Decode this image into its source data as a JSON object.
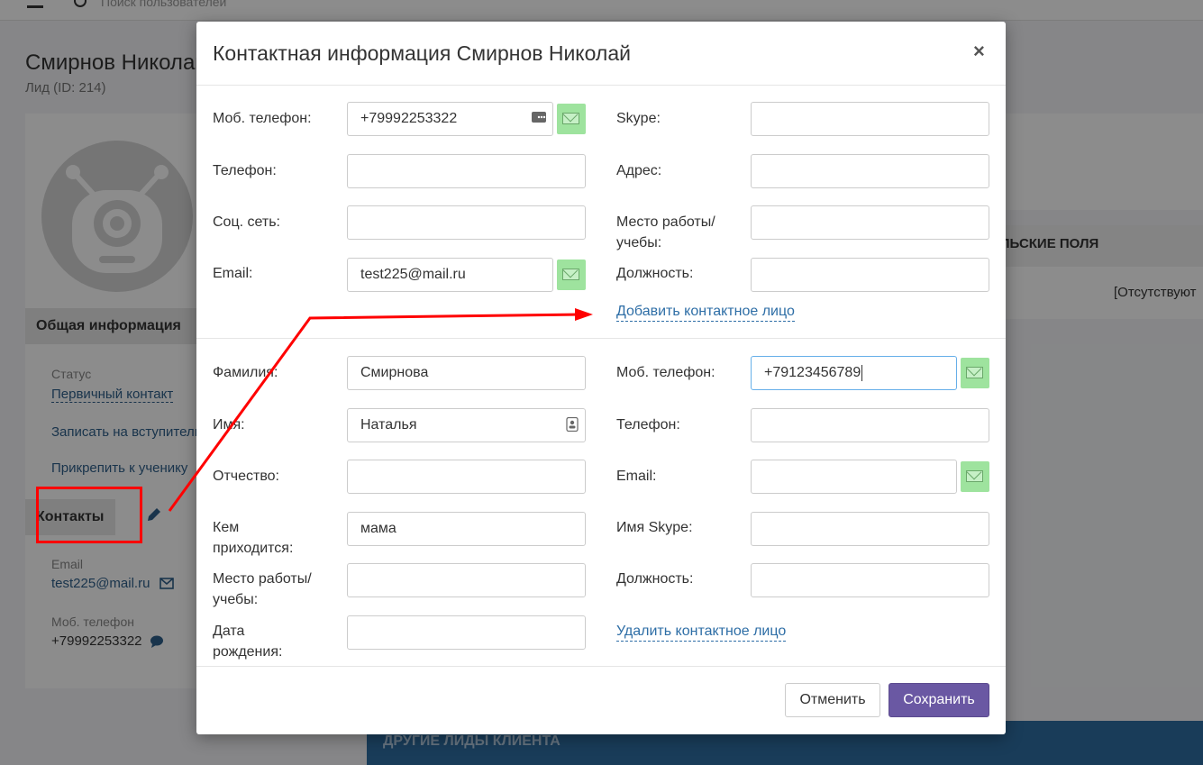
{
  "background": {
    "search_placeholder": "Поиск пользователей",
    "title": "Смирнов Николай",
    "subtitle": "Лид (ID: 214)",
    "section_general": "Общая информация",
    "status_label": "Статус",
    "status_value": "Первичный контакт",
    "link_enroll": "Записать на вступительное",
    "link_attach": "Прикрепить к ученику",
    "section_contacts": "Контакты",
    "email_label": "Email",
    "email_value": "test225@mail.ru",
    "mobile_label": "Моб. телефон",
    "mobile_value": "+79992253322",
    "right_header": "ЕЛЬСКИЕ ПОЛЯ",
    "right_value": "[Отсутствуют",
    "bottom_bar": "ДРУГИЕ ЛИДЫ КЛИЕНТА"
  },
  "modal": {
    "title": "Контактная информация Смирнов Николай",
    "close": "×",
    "main": {
      "mobile_label": "Моб. телефон:",
      "mobile_value": "+79992253322",
      "phone_label": "Телефон:",
      "phone_value": "",
      "social_label": "Соц. сеть:",
      "social_value": "",
      "email_label": "Email:",
      "email_value": "test225@mail.ru",
      "skype_label": "Skype:",
      "skype_value": "",
      "address_label": "Адрес:",
      "address_value": "",
      "work_label_1": "Место работы/",
      "work_label_2": "учебы:",
      "work_value": "",
      "position_label": "Должность:",
      "position_value": "",
      "add_contact": "Добавить контактное лицо"
    },
    "contact": {
      "lastname_label": "Фамилия:",
      "lastname_value": "Смирнова",
      "firstname_label": "Имя:",
      "firstname_value": "Наталья",
      "patronymic_label": "Отчество:",
      "patronymic_value": "",
      "relation_label_1": "Кем",
      "relation_label_2": "приходится:",
      "relation_value": "мама",
      "work_label_1": "Место работы/",
      "work_label_2": "учебы:",
      "work_value": "",
      "birth_label_1": "Дата",
      "birth_label_2": "рождения:",
      "birth_value": "",
      "mobile_label": "Моб. телефон:",
      "mobile_value": "+79123456789",
      "phone_label": "Телефон:",
      "phone_value": "",
      "email_label": "Email:",
      "email_value": "",
      "skype_label": "Имя Skype:",
      "skype_value": "",
      "position_label": "Должность:",
      "position_value": "",
      "delete_contact": "Удалить контактное лицо"
    },
    "cancel": "Отменить",
    "save": "Сохранить"
  },
  "colors": {
    "accent": "#6a58a3",
    "link": "#2e6ea6",
    "sms_button": "#9ee39e",
    "annotation": "#ff0000"
  }
}
